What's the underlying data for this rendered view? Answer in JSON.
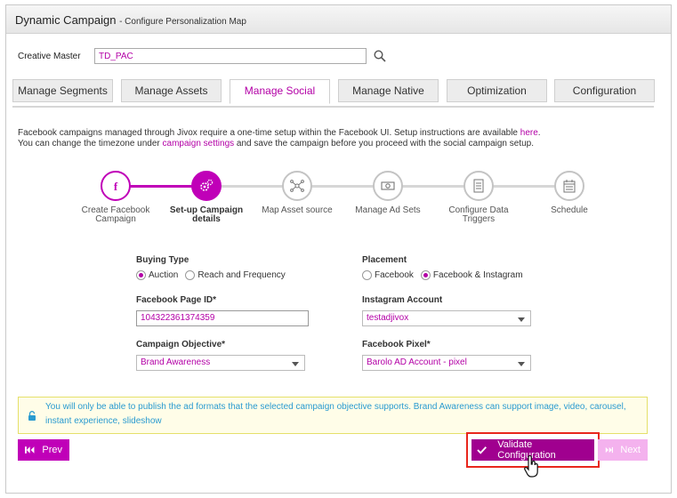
{
  "window": {
    "title": "Dynamic Campaign",
    "subtitle": "- Configure Personalization Map"
  },
  "creative_master": {
    "label": "Creative Master",
    "value": "TD_PAC",
    "icon": "search-icon"
  },
  "tabs": [
    {
      "label": "Manage Segments",
      "active": false
    },
    {
      "label": "Manage Assets",
      "active": false
    },
    {
      "label": "Manage Social",
      "active": true
    },
    {
      "label": "Manage Native",
      "active": false
    },
    {
      "label": "Optimization",
      "active": false
    },
    {
      "label": "Configuration",
      "active": false
    }
  ],
  "info": {
    "line1_pre": "Facebook campaigns managed through Jivox require a one-time setup within the Facebook UI. Setup instructions are available ",
    "line1_link": "here",
    "line1_post": ".",
    "line2_pre": "You can change the timezone under ",
    "line2_link": "campaign settings",
    "line2_post": " and save the campaign before you proceed with the social campaign setup."
  },
  "stepper": {
    "steps": [
      {
        "label": "Create Facebook Campaign",
        "icon": "facebook-icon",
        "state": "done"
      },
      {
        "label": "Set-up Campaign details",
        "icon": "gears-icon",
        "state": "active"
      },
      {
        "label": "Map Asset source",
        "icon": "network-icon",
        "state": "pending"
      },
      {
        "label": "Manage Ad Sets",
        "icon": "money-icon",
        "state": "pending"
      },
      {
        "label": "Configure Data Triggers",
        "icon": "checklist-icon",
        "state": "pending"
      },
      {
        "label": "Schedule",
        "icon": "calendar-icon",
        "state": "pending"
      }
    ]
  },
  "form": {
    "buying_type": {
      "label": "Buying Type",
      "options": [
        "Auction",
        "Reach and Frequency"
      ],
      "selected": "Auction"
    },
    "placement": {
      "label": "Placement",
      "options": [
        "Facebook",
        "Facebook & Instagram"
      ],
      "selected": "Facebook & Instagram"
    },
    "page_id": {
      "label": "Facebook Page ID*",
      "value": "104322361374359"
    },
    "instagram": {
      "label": "Instagram Account",
      "value": "testadjivox"
    },
    "objective": {
      "label": "Campaign Objective*",
      "value": "Brand Awareness"
    },
    "pixel": {
      "label": "Facebook Pixel*",
      "value": "Barolo AD Account - pixel"
    }
  },
  "notice": {
    "text": "You will only be able to publish the ad formats that the selected campaign objective supports. Brand Awareness can support image, video, carousel, instant experience, slideshow",
    "icon": "lock-icon"
  },
  "buttons": {
    "prev": "Prev",
    "validate": "Validate Configuration",
    "next": "Next"
  },
  "colors": {
    "accent": "#c000b8",
    "highlight": "#e8261c",
    "notice_text": "#2a9bd0"
  }
}
